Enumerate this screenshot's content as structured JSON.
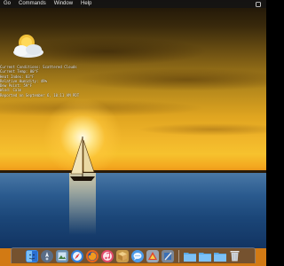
{
  "menubar": {
    "items": [
      "Go",
      "Commands",
      "Window",
      "Help"
    ],
    "right_icon": "menu-extra-icon"
  },
  "weather": {
    "lines": [
      "Current Conditions: Scattered Clouds",
      "Current Temp: 80°F",
      "Heat Index: 83°F",
      "Relative Humidity: 49%",
      "Dew Point: 59°F",
      "Wind: Calm",
      "Reported on September 6, 10:11 AM PDT"
    ],
    "icon": "partly-cloudy-icon"
  },
  "dock": {
    "apps": [
      {
        "name": "finder",
        "color": "#3b8ee8"
      },
      {
        "name": "launchpad",
        "color": "#5a6d86"
      },
      {
        "name": "preview",
        "color": "#6b8fb0"
      },
      {
        "name": "safari",
        "color": "#2f7fdc"
      },
      {
        "name": "firefox",
        "color": "#e8641c"
      },
      {
        "name": "itunes",
        "color": "#e24a6a"
      },
      {
        "name": "box-app",
        "color": "#c79a4a"
      },
      {
        "name": "messages",
        "color": "#4d9be8"
      },
      {
        "name": "sling",
        "color": "#9aa4b2"
      },
      {
        "name": "xcode",
        "color": "#7a8696"
      }
    ],
    "folders": [
      {
        "name": "applications-folder",
        "color": "#5aa9e6"
      },
      {
        "name": "documents-folder",
        "color": "#5aa9e6"
      },
      {
        "name": "downloads-folder",
        "color": "#5aa9e6"
      }
    ],
    "trash": {
      "name": "trash",
      "color": "#cfd4da"
    }
  },
  "colors": {
    "sky_top": "#1a1207",
    "sky_glow": "#f6c22e",
    "sea": "#2a5a8e"
  }
}
